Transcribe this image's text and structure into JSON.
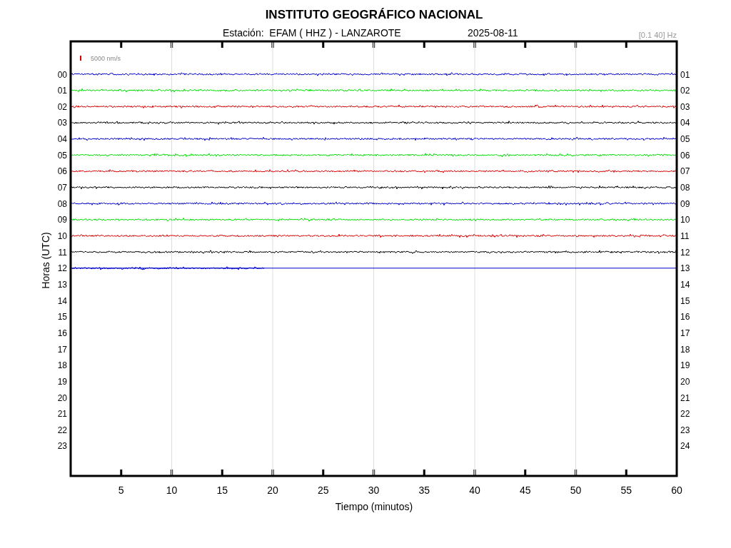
{
  "title": "INSTITUTO GEOGRÁFICO NACIONAL",
  "station": "Estación:  EFAM ( HHZ ) - LANZAROTE",
  "date": "2025-08-11",
  "filter": "[0.1 40] Hz",
  "scale_label": "5000 nm/s",
  "ylabel": "Horas (UTC)",
  "xlabel": "Tiempo (minutos)",
  "left_labels": [
    "00",
    "01",
    "02",
    "03",
    "04",
    "05",
    "06",
    "07",
    "08",
    "09",
    "10",
    "11",
    "12",
    "13",
    "14",
    "15",
    "16",
    "17",
    "18",
    "19",
    "20",
    "21",
    "22",
    "23"
  ],
  "right_labels": [
    "01",
    "02",
    "03",
    "04",
    "05",
    "06",
    "07",
    "08",
    "09",
    "10",
    "11",
    "12",
    "13",
    "14",
    "15",
    "16",
    "17",
    "18",
    "19",
    "20",
    "21",
    "22",
    "23",
    "24"
  ],
  "xticks": [
    "5",
    "10",
    "15",
    "20",
    "25",
    "30",
    "35",
    "40",
    "45",
    "50",
    "55",
    "60"
  ],
  "traces": [
    {
      "color": "#0000cc"
    },
    {
      "color": "#00e000"
    },
    {
      "color": "#dd0000"
    },
    {
      "color": "#000000"
    },
    {
      "color": "#0000cc"
    },
    {
      "color": "#00e000"
    },
    {
      "color": "#dd0000"
    },
    {
      "color": "#000000"
    },
    {
      "color": "#0000cc"
    },
    {
      "color": "#00e000"
    },
    {
      "color": "#dd0000"
    },
    {
      "color": "#000000"
    },
    {
      "color": "#0000cc",
      "level": 0.32
    }
  ]
}
